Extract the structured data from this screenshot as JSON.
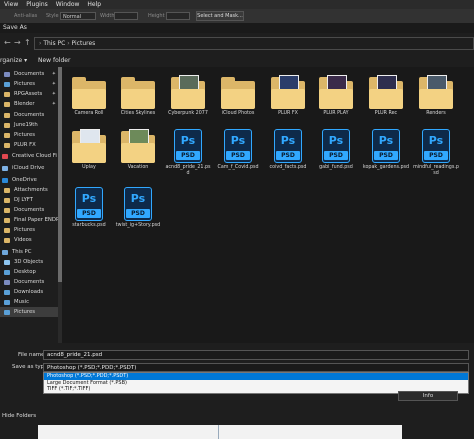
{
  "menubar": {
    "items": [
      "View",
      "Plugins",
      "Window",
      "Help"
    ]
  },
  "options_bar": {
    "labels": [
      "Anti-alias",
      "Style",
      "Width",
      "Height"
    ],
    "style_value": "Normal",
    "select_mask_label": "Select and Mask..."
  },
  "dialog": {
    "title": "Save As"
  },
  "nav": {
    "back": "←",
    "forward": "→",
    "up": "↑",
    "breadcrumb": [
      "This PC",
      "Pictures"
    ]
  },
  "toolbar": {
    "organize": "rganize ▾",
    "new_folder": "New folder"
  },
  "sidebar": {
    "items": [
      {
        "label": "Documents",
        "pinned": true,
        "icon": "documents-icon",
        "color": "#7c8cc0"
      },
      {
        "label": "Pictures",
        "pinned": true,
        "icon": "pictures-icon",
        "color": "#5aa0d8"
      },
      {
        "label": "RPGAssets",
        "pinned": true,
        "icon": "folder-icon",
        "color": "#dcb668"
      },
      {
        "label": "Blender",
        "pinned": true,
        "icon": "folder-icon",
        "color": "#dcb668"
      },
      {
        "label": "Documents",
        "pinned": false,
        "icon": "folder-icon",
        "color": "#dcb668"
      },
      {
        "label": "June19th",
        "pinned": false,
        "icon": "folder-icon",
        "color": "#dcb668"
      },
      {
        "label": "Pictures",
        "pinned": false,
        "icon": "folder-icon",
        "color": "#dcb668"
      },
      {
        "label": "PLUR FX",
        "pinned": false,
        "icon": "folder-icon",
        "color": "#dcb668"
      },
      {
        "label": "Creative Cloud Fi",
        "pinned": false,
        "icon": "creative-cloud-icon",
        "color": "#e34850"
      },
      {
        "label": "iCloud Drive",
        "pinned": false,
        "icon": "icloud-icon",
        "color": "#7fb2e5"
      },
      {
        "label": "OneDrive",
        "pinned": false,
        "icon": "onedrive-icon",
        "color": "#2b88d8"
      },
      {
        "label": "Attachments",
        "pinned": false,
        "icon": "folder-icon",
        "color": "#dcb668"
      },
      {
        "label": "DJ LYFT",
        "pinned": false,
        "icon": "folder-icon",
        "color": "#dcb668"
      },
      {
        "label": "Documents",
        "pinned": false,
        "icon": "folder-icon",
        "color": "#dcb668"
      },
      {
        "label": "Final Paper ENDP",
        "pinned": false,
        "icon": "folder-icon",
        "color": "#dcb668"
      },
      {
        "label": "Pictures",
        "pinned": false,
        "icon": "folder-icon",
        "color": "#dcb668"
      },
      {
        "label": "Videos",
        "pinned": false,
        "icon": "folder-icon",
        "color": "#dcb668"
      },
      {
        "label": "This PC",
        "pinned": false,
        "icon": "this-pc-icon",
        "color": "#6fa8dc"
      },
      {
        "label": "3D Objects",
        "pinned": false,
        "icon": "3d-objects-icon",
        "color": "#8ec5f0"
      },
      {
        "label": "Desktop",
        "pinned": false,
        "icon": "desktop-icon",
        "color": "#5aa0d8"
      },
      {
        "label": "Documents",
        "pinned": false,
        "icon": "documents-icon",
        "color": "#7c8cc0"
      },
      {
        "label": "Downloads",
        "pinned": false,
        "icon": "downloads-icon",
        "color": "#5aa0d8"
      },
      {
        "label": "Music",
        "pinned": false,
        "icon": "music-icon",
        "color": "#5aa0d8"
      },
      {
        "label": "Pictures",
        "pinned": false,
        "icon": "pictures-icon",
        "color": "#5aa0d8",
        "selected": true
      }
    ]
  },
  "files": [
    {
      "name": "Camera Roll",
      "type": "folder",
      "photo": ""
    },
    {
      "name": "Cities Skylines",
      "type": "folder",
      "photo": ""
    },
    {
      "name": "Cyberpunk 2077",
      "type": "folder",
      "photo": "#5a6b5a"
    },
    {
      "name": "iCloud Photos",
      "type": "folder",
      "photo": ""
    },
    {
      "name": "PLUR FX",
      "type": "folder",
      "photo": "#2b3d6a"
    },
    {
      "name": "PLUR PLAY",
      "type": "folder",
      "photo": "#3b2b4a"
    },
    {
      "name": "PLUR Rec",
      "type": "folder",
      "photo": "#2e2e4e"
    },
    {
      "name": "Renders",
      "type": "folder",
      "photo": "#4a5a6a"
    },
    {
      "name": "Uplay",
      "type": "folder",
      "photo": "#dfe6ee"
    },
    {
      "name": "Vacation",
      "type": "folder",
      "photo": "#6d8a5a"
    },
    {
      "name": "acnd8_pride_21.psd",
      "type": "psd"
    },
    {
      "name": "Cam_f_Covid.psd",
      "type": "psd"
    },
    {
      "name": "coivd_facts.psd",
      "type": "psd"
    },
    {
      "name": "gabi_fund.psd",
      "type": "psd"
    },
    {
      "name": "kopak_gardens.psd",
      "type": "psd"
    },
    {
      "name": "mindful_readings.psd",
      "type": "psd"
    },
    {
      "name": "starbucks.psd",
      "type": "psd"
    },
    {
      "name": "twist_ig+Story.psd",
      "type": "psd"
    }
  ],
  "psd_icon": {
    "ps": "Ps",
    "label": "PSD",
    "accent": "#31a8ff"
  },
  "save_form": {
    "file_name_label": "File name:",
    "file_name_value": "acnd8_pride_21.psd",
    "save_type_label": "Save as type:",
    "save_type_value": "Photoshop (*.PSD;*.PDD;*.PSDT)",
    "options": [
      "Photoshop (*.PSD;*.PDD;*.PSDT)",
      "Large Document Format (*.PSB)",
      "TIFF (*.TIF;*.TIFF)"
    ],
    "info_button": "Info",
    "hide_folders": "Hide Folders"
  }
}
